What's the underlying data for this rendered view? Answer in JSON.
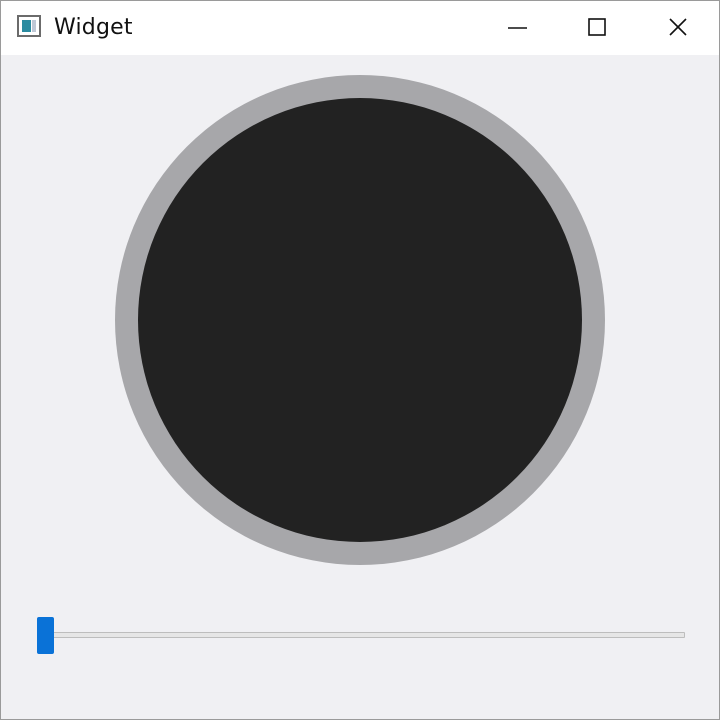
{
  "window": {
    "title": "Widget",
    "icon": "app-window-icon"
  },
  "caption_buttons": {
    "minimize_icon": "minimize-icon",
    "maximize_icon": "maximize-icon",
    "close_icon": "close-icon"
  },
  "dial": {
    "ring_color": "#a7a7aa",
    "fill_color": "#222222"
  },
  "slider": {
    "value_fraction": 0.0,
    "handle_color": "#0a72d7"
  }
}
